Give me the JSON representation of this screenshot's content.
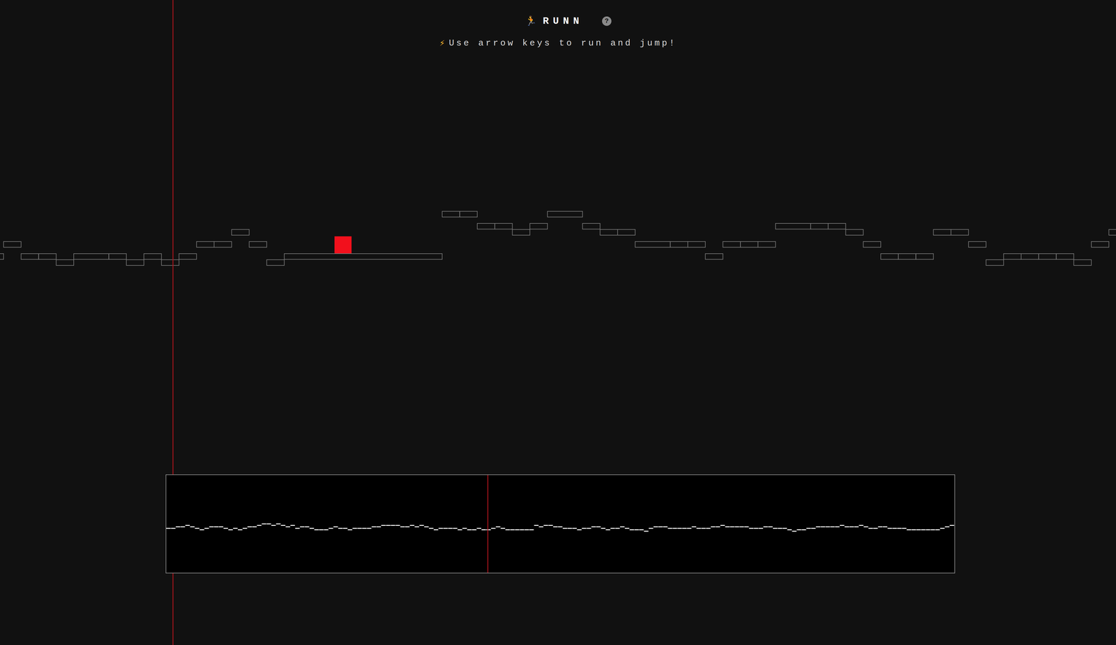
{
  "header": {
    "title_icon": "🏃",
    "title": "RUNN",
    "help": "?",
    "subtitle_icon": "⚡",
    "subtitle": "Use arrow keys to run and jump!"
  },
  "player": {
    "color": "#f2101c"
  },
  "platforms": [
    {
      "span": 1,
      "level": 1
    },
    {
      "span": 1,
      "level": 3
    },
    {
      "span": 1,
      "level": 1
    },
    {
      "span": 1,
      "level": 1
    },
    {
      "span": 1,
      "level": 0
    },
    {
      "span": 2,
      "level": 1
    },
    {
      "span": 1,
      "level": 1
    },
    {
      "span": 1,
      "level": 0
    },
    {
      "span": 1,
      "level": 1
    },
    {
      "span": 1,
      "level": 0
    },
    {
      "span": 1,
      "level": 1
    },
    {
      "span": 1,
      "level": 3
    },
    {
      "span": 1,
      "level": 3
    },
    {
      "span": 1,
      "level": 5
    },
    {
      "span": 1,
      "level": 3
    },
    {
      "span": 1,
      "level": 0
    },
    {
      "span": 9,
      "level": 1
    },
    {
      "span": 1,
      "level": 8
    },
    {
      "span": 1,
      "level": 8
    },
    {
      "span": 1,
      "level": 6
    },
    {
      "span": 1,
      "level": 6
    },
    {
      "span": 1,
      "level": 5
    },
    {
      "span": 1,
      "level": 6
    },
    {
      "span": 2,
      "level": 8
    },
    {
      "span": 1,
      "level": 6
    },
    {
      "span": 1,
      "level": 5
    },
    {
      "span": 1,
      "level": 5
    },
    {
      "span": 2,
      "level": 3
    },
    {
      "span": 1,
      "level": 3
    },
    {
      "span": 1,
      "level": 3
    },
    {
      "span": 1,
      "level": 1
    },
    {
      "span": 1,
      "level": 3
    },
    {
      "span": 1,
      "level": 3
    },
    {
      "span": 1,
      "level": 3
    },
    {
      "span": 2,
      "level": 6
    },
    {
      "span": 1,
      "level": 6
    },
    {
      "span": 1,
      "level": 6
    },
    {
      "span": 1,
      "level": 5
    },
    {
      "span": 1,
      "level": 3
    },
    {
      "span": 1,
      "level": 1
    },
    {
      "span": 1,
      "level": 1
    },
    {
      "span": 1,
      "level": 1
    },
    {
      "span": 1,
      "level": 5
    },
    {
      "span": 1,
      "level": 5
    },
    {
      "span": 1,
      "level": 3
    },
    {
      "span": 1,
      "level": 0
    },
    {
      "span": 1,
      "level": 1
    },
    {
      "span": 1,
      "level": 1
    },
    {
      "span": 1,
      "level": 1
    },
    {
      "span": 1,
      "level": 1
    },
    {
      "span": 1,
      "level": 0
    },
    {
      "span": 1,
      "level": 3
    },
    {
      "span": 1,
      "level": 5
    }
  ],
  "minimap": {
    "progress": 0.408,
    "levels": [
      0,
      0,
      1,
      1,
      2,
      1,
      0,
      -1,
      0,
      1,
      1,
      1,
      0,
      -1,
      0,
      -1,
      0,
      1,
      1,
      2,
      3,
      3,
      2,
      3,
      2,
      1,
      2,
      0,
      1,
      1,
      0,
      -1,
      -1,
      -1,
      0,
      1,
      0,
      0,
      -1,
      0,
      0,
      0,
      0,
      1,
      1,
      2,
      2,
      2,
      2,
      1,
      1,
      2,
      1,
      2,
      1,
      0,
      -1,
      0,
      0,
      0,
      0,
      -1,
      0,
      -1,
      -1,
      0,
      -1,
      -1,
      0,
      1,
      0,
      -1,
      -1,
      -1,
      -1,
      -1,
      -1,
      2,
      1,
      2,
      2,
      1,
      1,
      0,
      0,
      0,
      -1,
      0,
      0,
      1,
      1,
      0,
      -1,
      0,
      0,
      1,
      0,
      -1,
      -1,
      -1,
      -2,
      0,
      1,
      1,
      1,
      0,
      0,
      0,
      0,
      0,
      1,
      0,
      0,
      0,
      1,
      1,
      2,
      1,
      1,
      1,
      1,
      1,
      0,
      0,
      0,
      1,
      1,
      0,
      0,
      0,
      -1,
      -2,
      -1,
      -1,
      0,
      0,
      1,
      1,
      1,
      1,
      1,
      2,
      1,
      1,
      1,
      2,
      1,
      0,
      0,
      1,
      1,
      0,
      0,
      0,
      0,
      -1,
      -1,
      -1,
      -1,
      -1,
      -1,
      -1,
      0,
      1,
      2
    ]
  }
}
